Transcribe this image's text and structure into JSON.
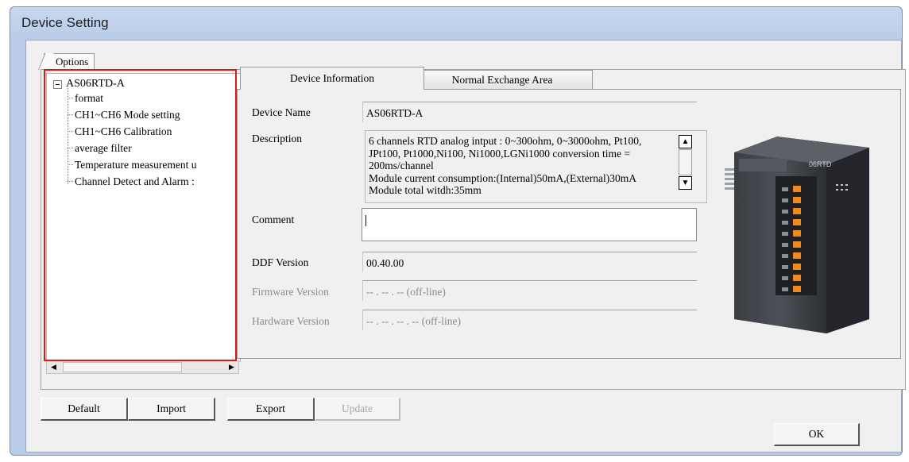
{
  "window": {
    "title": "Device Setting"
  },
  "options_tab": "Options",
  "tree": {
    "root": "AS06RTD-A",
    "children": [
      "format",
      "CH1~CH6 Mode setting",
      "CH1~CH6 Calibration",
      "average filter",
      "Temperature measurement u",
      "Channel Detect and Alarm :"
    ]
  },
  "tabs": {
    "active": "Device Information",
    "inactive": "Normal Exchange Area"
  },
  "device": {
    "name_label": "Device Name",
    "name": "AS06RTD-A",
    "description_label": "Description",
    "description": [
      "6 channels RTD analog intput : 0~300ohm, 0~3000ohm, Pt100,",
      "JPt100, Pt1000,Ni100, Ni1000,LGNi1000 conversion time =",
      "200ms/channel",
      "Module current consumption:(Internal)50mA,(External)30mA",
      "Module total witdh:35mm"
    ],
    "comment_label": "Comment",
    "comment": "",
    "ddf_label": "DDF Version",
    "ddf": "00.40.00",
    "firmware_label": "Firmware Version",
    "firmware": "-- . -- . -- (off-line)",
    "hardware_label": "Hardware Version",
    "hardware": "-- . -- . -- . -- (off-line)",
    "module_label": "06RTD"
  },
  "buttons": {
    "default": "Default",
    "import": "Import",
    "export": "Export",
    "update": "Update",
    "ok": "OK"
  }
}
